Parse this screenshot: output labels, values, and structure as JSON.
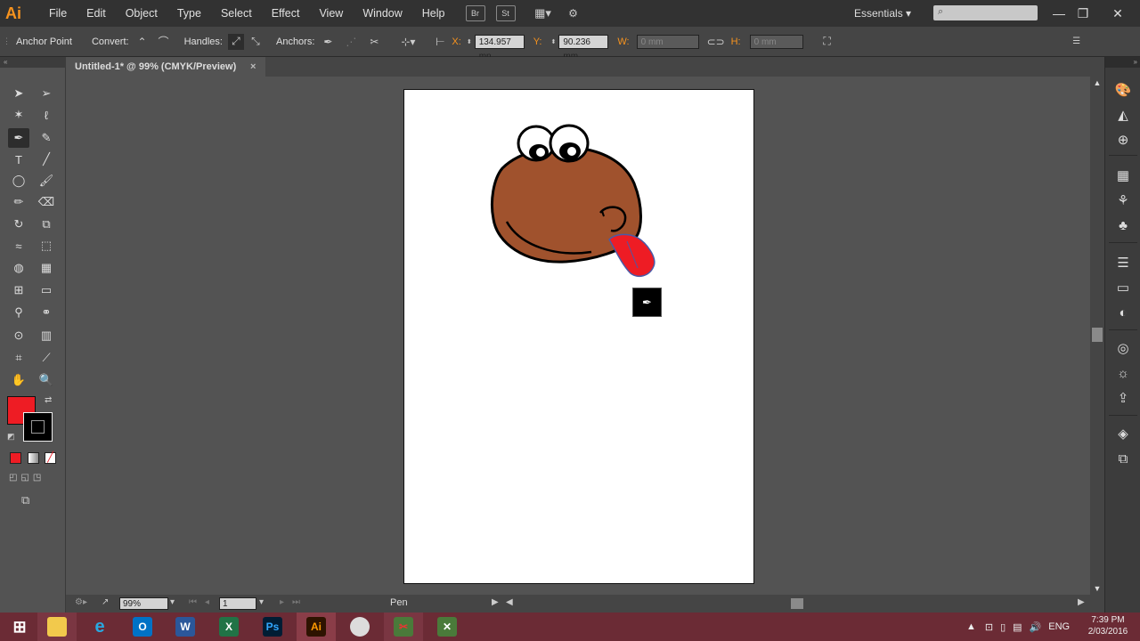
{
  "app": {
    "logo": "Ai",
    "brand_color": "#f7931e"
  },
  "menu": {
    "items": [
      "File",
      "Edit",
      "Object",
      "Type",
      "Select",
      "Effect",
      "View",
      "Window",
      "Help"
    ],
    "bridge_label": "Br",
    "stock_label": "St",
    "workspace": "Essentials"
  },
  "control_bar": {
    "tool_name": "Anchor Point",
    "convert_label": "Convert:",
    "handles_label": "Handles:",
    "anchors_label": "Anchors:",
    "x_label": "X:",
    "x_value": "134.957 mn",
    "y_label": "Y:",
    "y_value": "90.236 mm",
    "w_label": "W:",
    "w_value": "0 mm",
    "h_label": "H:",
    "h_value": "0 mm"
  },
  "document": {
    "tab_title": "Untitled-1* @ 99% (CMYK/Preview)",
    "close_glyph": "×"
  },
  "colors": {
    "fill": "#ee1c24",
    "stroke": "#000000",
    "character_body": "#a0522d",
    "tongue": "#ee1c24",
    "taskbar": "#6b2b35"
  },
  "status_bar": {
    "zoom": "99%",
    "page": "1",
    "current_tool": "Pen"
  },
  "taskbar": {
    "apps": [
      {
        "name": "windows-start",
        "label": ""
      },
      {
        "name": "file-explorer",
        "label": ""
      },
      {
        "name": "internet-explorer",
        "label": "e"
      },
      {
        "name": "outlook",
        "label": "O"
      },
      {
        "name": "word",
        "label": "W"
      },
      {
        "name": "excel",
        "label": "X"
      },
      {
        "name": "photoshop",
        "label": "Ps"
      },
      {
        "name": "illustrator",
        "label": "Ai"
      },
      {
        "name": "paint",
        "label": ""
      },
      {
        "name": "snipping-tool",
        "label": ""
      },
      {
        "name": "camtasia",
        "label": ""
      }
    ],
    "language": "ENG",
    "time": "7:39 PM",
    "date": "2/03/2016"
  }
}
